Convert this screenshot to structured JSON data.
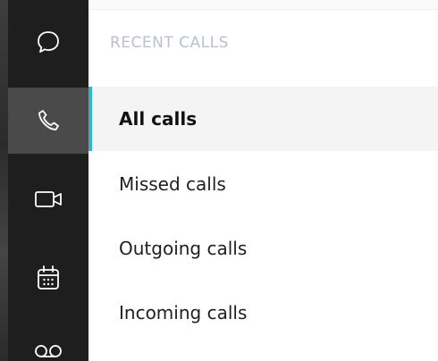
{
  "rail": {
    "items": [
      {
        "icon": "chat-bubble-icon",
        "active": false
      },
      {
        "icon": "phone-icon",
        "active": true
      },
      {
        "icon": "video-camera-icon",
        "active": false
      },
      {
        "icon": "calendar-icon",
        "active": false
      },
      {
        "icon": "voicemail-icon",
        "active": false
      }
    ]
  },
  "recent_calls": {
    "title": "RECENT CALLS",
    "items": [
      {
        "label": "All calls",
        "active": true
      },
      {
        "label": "Missed calls",
        "active": false
      },
      {
        "label": "Outgoing calls",
        "active": false
      },
      {
        "label": "Incoming calls",
        "active": false
      }
    ]
  },
  "colors": {
    "accent": "#33b6c9",
    "rail_bg": "#1e1e1e",
    "rail_active_bg": "#4a4a4a",
    "section_title": "#b8c1cc"
  }
}
